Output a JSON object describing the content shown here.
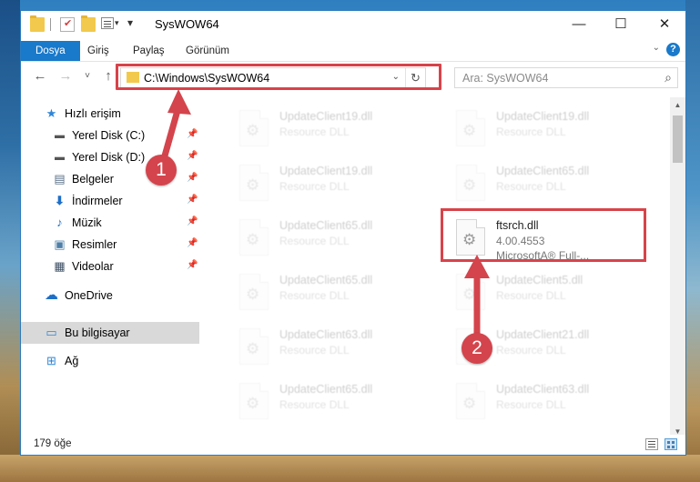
{
  "window": {
    "title": "SysWOW64",
    "controls": {
      "minimize": "—",
      "maximize": "☐",
      "close": "✕"
    }
  },
  "ribbon": {
    "tabs": [
      "Dosya",
      "Giriş",
      "Paylaş",
      "Görünüm"
    ],
    "help": "?"
  },
  "nav": {
    "back": "←",
    "forward": "→",
    "recent": "˅",
    "up": "↑",
    "address": "C:\\Windows\\SysWOW64",
    "search_placeholder": "Ara: SysWOW64"
  },
  "sidebar": {
    "items": [
      {
        "label": "Hızlı erişim",
        "icon": "star-icon",
        "pinned": false
      },
      {
        "label": "Yerel Disk (C:)",
        "icon": "drive-icon",
        "pinned": true
      },
      {
        "label": "Yerel Disk (D:)",
        "icon": "drive-icon",
        "pinned": true
      },
      {
        "label": "Belgeler",
        "icon": "documents-icon",
        "pinned": true
      },
      {
        "label": "İndirmeler",
        "icon": "download-icon",
        "pinned": true
      },
      {
        "label": "Müzik",
        "icon": "music-icon",
        "pinned": true
      },
      {
        "label": "Resimler",
        "icon": "pictures-icon",
        "pinned": true
      },
      {
        "label": "Videolar",
        "icon": "videos-icon",
        "pinned": true
      },
      {
        "label": "OneDrive",
        "icon": "cloud-icon",
        "pinned": false
      },
      {
        "label": "Bu bilgisayar",
        "icon": "computer-icon",
        "pinned": false,
        "selected": true
      },
      {
        "label": "Ağ",
        "icon": "network-icon",
        "pinned": false
      }
    ]
  },
  "files": [
    {
      "name": "UpdateClient19.dll",
      "line2": "Resource DLL",
      "line3": "",
      "faded": true
    },
    {
      "name": "UpdateClient19.dll",
      "line2": "Resource DLL",
      "line3": "",
      "faded": true
    },
    {
      "name": "UpdateClient19.dll",
      "line2": "Resource DLL",
      "line3": "",
      "faded": true
    },
    {
      "name": "UpdateClient65.dll",
      "line2": "Resource DLL",
      "line3": "",
      "faded": true
    },
    {
      "name": "UpdateClient65.dll",
      "line2": "Resource DLL",
      "line3": "",
      "faded": true
    },
    {
      "name": "ftsrch.dll",
      "line2": "4.00.4553",
      "line3": "MicrosoftA® Full-...",
      "faded": false
    },
    {
      "name": "UpdateClient65.dll",
      "line2": "Resource DLL",
      "line3": "",
      "faded": true
    },
    {
      "name": "UpdateClient5.dll",
      "line2": "Resource DLL",
      "line3": "",
      "faded": true
    },
    {
      "name": "UpdateClient63.dll",
      "line2": "Resource DLL",
      "line3": "",
      "faded": true
    },
    {
      "name": "UpdateClient21.dll",
      "line2": "Resource DLL",
      "line3": "",
      "faded": true
    },
    {
      "name": "UpdateClient65.dll",
      "line2": "Resource DLL",
      "line3": "",
      "faded": true
    },
    {
      "name": "UpdateClient63.dll",
      "line2": "Resource DLL",
      "line3": "",
      "faded": true
    }
  ],
  "status": {
    "count": "179 öğe"
  },
  "annotations": {
    "step1": "1",
    "step2": "2",
    "color": "#d4444c"
  }
}
